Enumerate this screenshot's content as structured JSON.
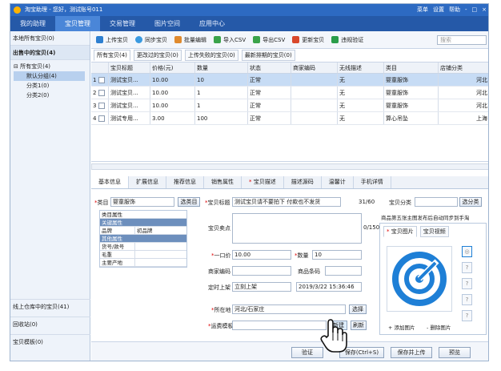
{
  "app": {
    "title": "淘宝助理 - 您好，测试账号011",
    "top_links": [
      "菜单",
      "设置",
      "帮助",
      "-",
      "□",
      "×"
    ]
  },
  "nav": {
    "tabs": [
      "我的助理",
      "宝贝管理",
      "交易管理",
      "图片空间",
      "应用中心"
    ]
  },
  "sidebar": {
    "local": "本地所有宝贝(0)",
    "selling": "出售中的宝贝(4)",
    "tree": [
      "所有宝贝(4)",
      "默认分组(4)",
      "分类1(0)",
      "分类2(0)"
    ],
    "warehouse": "线上仓库中的宝贝(41)",
    "recycle": "回收站(0)",
    "templates": "宝贝模板(0)"
  },
  "toolbar": {
    "items": [
      "上传宝贝",
      "同步宝贝",
      "批量编辑",
      "导入CSV",
      "导出CSV",
      "更新宝贝",
      "违规验证"
    ],
    "search_placeholder": "搜索"
  },
  "subtabs": [
    "所有宝贝(4)",
    "更改过的宝贝(0)",
    "上传失败的宝贝(0)",
    "最新排期的宝贝(0)"
  ],
  "table": {
    "headers": [
      "",
      "宝贝标题",
      "价格(元)",
      "数量",
      "状态",
      "商家编码",
      "无线描述",
      "类目",
      "店铺分类"
    ],
    "rows": [
      {
        "n": "1",
        "title": "测试宝贝...",
        "price": "10.00",
        "qty": "10",
        "status": "正常",
        "code": "",
        "wireless": "无",
        "cat": "婴童服饰",
        "shop": "河北"
      },
      {
        "n": "2",
        "title": "测试宝贝...",
        "price": "10.00",
        "qty": "1",
        "status": "正常",
        "code": "",
        "wireless": "无",
        "cat": "婴童服饰",
        "shop": "河北"
      },
      {
        "n": "3",
        "title": "测试宝贝...",
        "price": "10.00",
        "qty": "1",
        "status": "正常",
        "code": "",
        "wireless": "无",
        "cat": "婴童服饰",
        "shop": "河北"
      },
      {
        "n": "4",
        "title": "测试专用...",
        "price": "3.00",
        "qty": "100",
        "status": "正常",
        "code": "",
        "wireless": "无",
        "cat": "算心吊坠",
        "shop": "上海"
      }
    ]
  },
  "detail_tabs": [
    "基本信息",
    "扩展信息",
    "推荐信息",
    "销售属性",
    "宝贝描述",
    "描述源码",
    "温馨计",
    "手机详情"
  ],
  "form": {
    "category_label": "类目",
    "category_value": "婴童服饰",
    "select_btn": "选类目",
    "title_label": "宝贝标题",
    "title_value": "测试宝贝请不要拍下 付款也不发货",
    "title_count": "31/60",
    "shop_cat_label": "宝贝分类",
    "shop_cat_btn": "选分类",
    "sellpoint_label": "宝贝卖点",
    "sellpoint_count": "0/150",
    "attr_title": "类目属性",
    "attrs": [
      {
        "k": "关键属性",
        "v": ""
      },
      {
        "k": "品牌",
        "v": "初品牌"
      },
      {
        "k": "其他属性",
        "v": ""
      },
      {
        "k": "货号/款号",
        "v": ""
      },
      {
        "k": "毛重",
        "v": ""
      },
      {
        "k": "主要产地",
        "v": ""
      }
    ],
    "price_label": "一口价",
    "price_value": "10.00",
    "qty_label": "数量",
    "qty_value": "10",
    "merchant_label": "商家编码",
    "barcode_label": "商品条码",
    "listing_label": "定时上架",
    "listing_value": "立刻上架",
    "listing_time": "2019/3/22 15:36:46",
    "location_label": "所在地",
    "location_value": "河北/石家庄",
    "location_btn": "选择",
    "shipping_label": "运费模板",
    "shipping_btn_new": "新建",
    "shipping_btn_refresh": "刷新",
    "image_hint": "商品第五张主图发布后自动同步到手淘",
    "img_tab_main": "宝贝图片",
    "img_tab_video": "宝贝视频",
    "add_image": "+ 添加图片",
    "delete_image": "- 删除图片"
  },
  "bottom": {
    "verify": "验证",
    "save": "保存(Ctrl+S)",
    "save_upload": "保存并上传",
    "preview": "预览"
  },
  "colors": {
    "nav": "#2559a8",
    "accent": "#1e7fd6",
    "selected_row": "#c7dcf5"
  }
}
